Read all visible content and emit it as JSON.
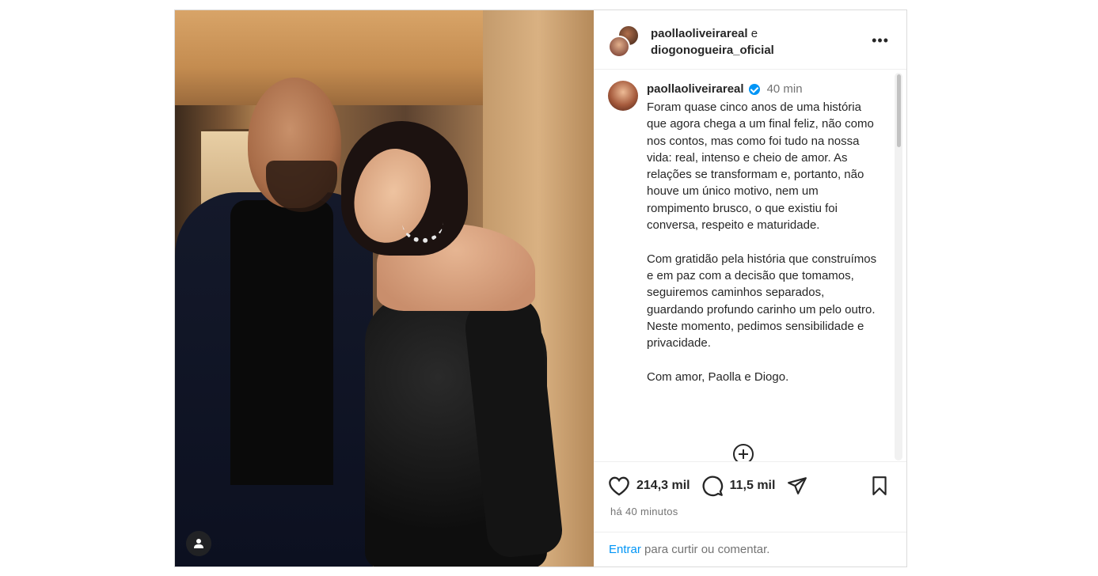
{
  "post": {
    "header": {
      "user1": "paollaoliveirareal",
      "connector": "e",
      "user2": "diogonogueira_oficial",
      "more_label": "•••"
    },
    "caption": {
      "username": "paollaoliveirareal",
      "time": "40 min",
      "text": "Foram quase cinco anos de uma história que agora chega a um final feliz, não como nos contos, mas como foi tudo na nossa vida: real, intenso e cheio de amor. As relações se transformam e, portanto, não houve um único motivo, nem um rompimento brusco, o que existiu foi conversa, respeito e maturidade.\n\nCom gratidão pela história que construímos e em paz com a decisão que tomamos, seguiremos caminhos separados, guardando profundo carinho um pelo outro. Neste momento, pedimos sensibilidade e privacidade.\n\nCom amor, Paolla e Diogo."
    },
    "actions": {
      "likes": "214,3 mil",
      "comments": "11,5 mil",
      "posted_ago": "há 40 minutos"
    },
    "login": {
      "link": "Entrar",
      "text": " para curtir ou comentar."
    }
  },
  "colors": {
    "accent": "#0095f6",
    "text": "#262626",
    "muted": "#737373",
    "border": "#dbdbdb"
  },
  "icons": [
    "user-tag-icon",
    "more-icon",
    "verified-badge-icon",
    "add-circle-icon",
    "heart-icon",
    "comment-icon",
    "share-icon",
    "bookmark-icon"
  ]
}
